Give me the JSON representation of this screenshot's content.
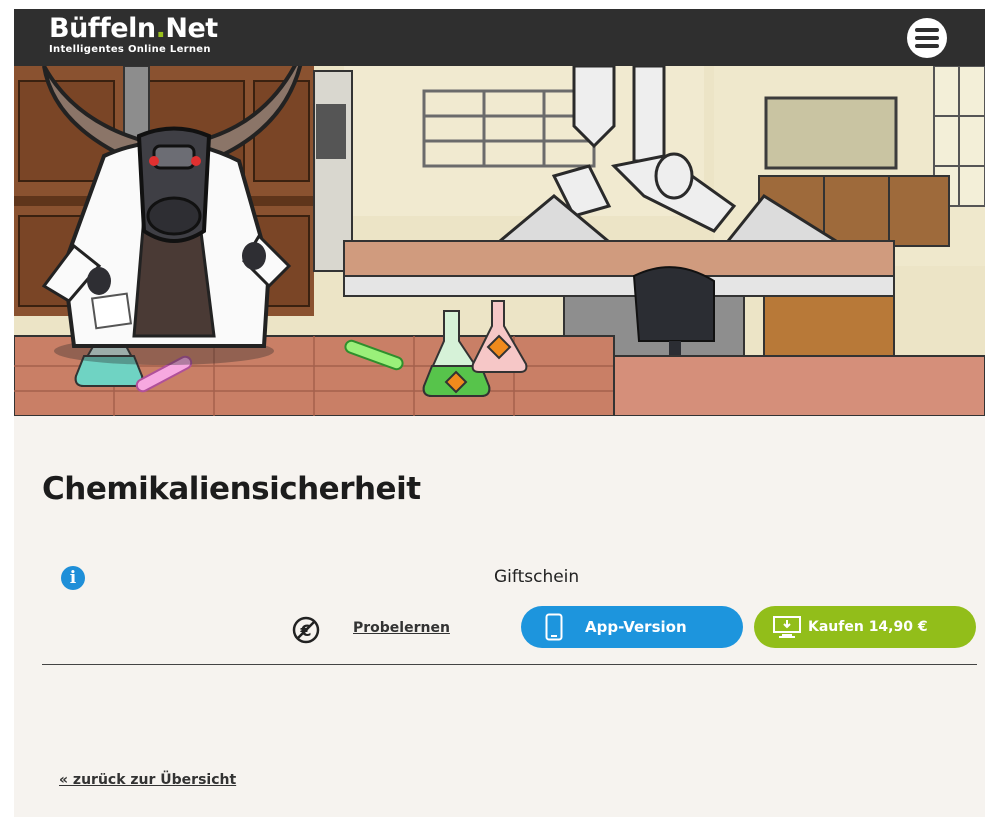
{
  "header": {
    "logo_main_a": "Büffeln",
    "logo_dot": ".",
    "logo_main_b": "Net",
    "logo_sub": "Intelligentes Online Lernen"
  },
  "content": {
    "title": "Chemikaliensicherheit",
    "subtitle": "Giftschein",
    "probe_label": "Probelernen",
    "app_button_label": "App-Version",
    "buy_button_label": "Kaufen 14,90 €",
    "back_link": "« zurück zur Übersicht"
  },
  "colors": {
    "header_bg": "#2f2f2f",
    "accent_green": "#92be1a",
    "accent_blue": "#1d95dd",
    "page_bg": "#f6f3ef"
  },
  "icons": {
    "menu": "hamburger-menu-icon",
    "info": "info-icon",
    "no_cost": "euro-crossed-icon",
    "app": "smartphone-icon",
    "buy": "computer-download-icon"
  }
}
